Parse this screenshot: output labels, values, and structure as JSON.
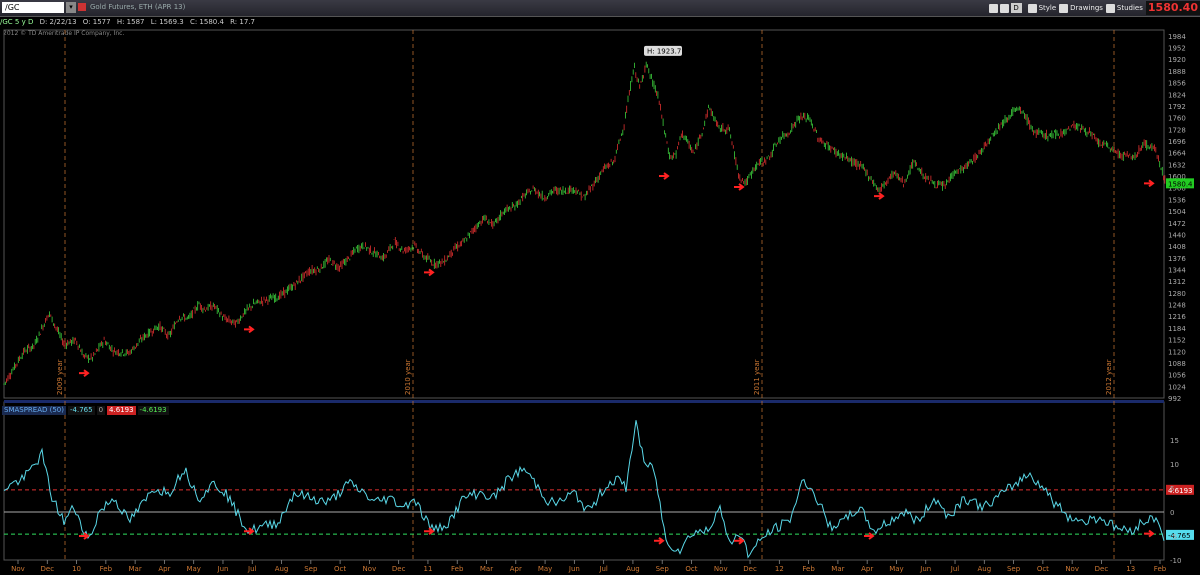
{
  "toolbar": {
    "symbol": "/GC",
    "instrument": "Gold Futures, ETH (APR 13)",
    "style_label": "Style",
    "drawings_label": "Drawings",
    "studies_label": "Studies",
    "d_label": "D",
    "last_price": "1580.40"
  },
  "info": {
    "symbol": "/GC 5 y D",
    "date": "D: 2/22/13",
    "open": "O: 1577",
    "high": "H: 1587",
    "low": "L: 1569.3",
    "close": "C: 1580.4",
    "range": "R: 17.7"
  },
  "copyright": "2012 © TD Ameritrade IP Company, Inc.",
  "indicator": {
    "name": "SMASPREAD (50)",
    "value": "-4.765",
    "zero": "0",
    "upper": "4.6193",
    "lower": "-4.6193"
  },
  "colors": {
    "up": "#3cd03c",
    "down": "#e03030",
    "spread": "#5ad8e8",
    "axis": "#cc7733",
    "upper": "#e03030",
    "lower": "#30e060"
  },
  "chart_data": [
    {
      "type": "bar",
      "series_style": "candlestick",
      "y_ticks": [
        1984,
        1952,
        1920,
        1888,
        1856,
        1824,
        1792,
        1760,
        1728,
        1696,
        1664,
        1632,
        1600,
        1568,
        1536,
        1504,
        1472,
        1440,
        1408,
        1376,
        1344,
        1312,
        1280,
        1248,
        1216,
        1184,
        1152,
        1120,
        1088,
        1056,
        1024,
        992
      ],
      "ylim": [
        992,
        2000
      ],
      "year_markers": [
        "2009 year",
        "2010 year",
        "2011 year",
        "2012 year"
      ],
      "high_label": "H: 1923.7",
      "last_label": "1580.4",
      "x": [
        0,
        20,
        30,
        45,
        60,
        72,
        80,
        88,
        100,
        110,
        125,
        140,
        155,
        165,
        175,
        185,
        195,
        200,
        210,
        220,
        232,
        240,
        250,
        260,
        275,
        290,
        305,
        315,
        325,
        335,
        345,
        352,
        360,
        370,
        380,
        390,
        400,
        410,
        420,
        430,
        440,
        450,
        460,
        470,
        480,
        490,
        500,
        510,
        520,
        530,
        540,
        550,
        560,
        570,
        580,
        590,
        600,
        610,
        620,
        630,
        636,
        642,
        648,
        654,
        660,
        666,
        672,
        678,
        690,
        700,
        705,
        715,
        725,
        735,
        742,
        752,
        765,
        775,
        785,
        795,
        805,
        815,
        825,
        835,
        845,
        860,
        875,
        890,
        900,
        910,
        920,
        930,
        940,
        950,
        960,
        975,
        990,
        1000,
        1010,
        1015,
        1020,
        1030,
        1045,
        1060,
        1070,
        1085,
        1095,
        1105,
        1115,
        1130,
        1140,
        1152,
        1162
      ],
      "values": [
        1030,
        1120,
        1135,
        1225,
        1140,
        1150,
        1105,
        1100,
        1150,
        1120,
        1115,
        1160,
        1190,
        1160,
        1215,
        1210,
        1250,
        1235,
        1245,
        1210,
        1195,
        1225,
        1250,
        1260,
        1270,
        1300,
        1340,
        1345,
        1370,
        1350,
        1375,
        1400,
        1410,
        1390,
        1375,
        1420,
        1395,
        1410,
        1380,
        1360,
        1365,
        1400,
        1420,
        1455,
        1485,
        1465,
        1505,
        1515,
        1545,
        1565,
        1540,
        1560,
        1560,
        1565,
        1540,
        1580,
        1620,
        1640,
        1740,
        1900,
        1840,
        1910,
        1860,
        1820,
        1730,
        1650,
        1660,
        1720,
        1660,
        1740,
        1790,
        1730,
        1730,
        1600,
        1580,
        1630,
        1650,
        1700,
        1720,
        1760,
        1760,
        1700,
        1680,
        1660,
        1645,
        1620,
        1560,
        1610,
        1580,
        1640,
        1600,
        1580,
        1570,
        1610,
        1620,
        1660,
        1720,
        1750,
        1780,
        1780,
        1770,
        1720,
        1710,
        1720,
        1740,
        1720,
        1690,
        1680,
        1660,
        1650,
        1690,
        1670,
        1580
      ]
    },
    {
      "type": "line",
      "ylim": [
        -10,
        20
      ],
      "y_ticks": [
        15,
        10,
        5,
        0,
        -5,
        -10
      ],
      "x_ticks": [
        "Nov",
        "Dec",
        "10",
        "Feb",
        "Mar",
        "Apr",
        "May",
        "Jun",
        "Jul",
        "Aug",
        "Sep",
        "Oct",
        "Nov",
        "Dec",
        "11",
        "Feb",
        "Mar",
        "Apr",
        "May",
        "Jun",
        "Jul",
        "Aug",
        "Sep",
        "Oct",
        "Nov",
        "Dec",
        "12",
        "Feb",
        "Mar",
        "Apr",
        "May",
        "Jun",
        "Jul",
        "Aug",
        "Sep",
        "Oct",
        "Nov",
        "Dec",
        "13",
        "Feb"
      ],
      "last_label": "-4.765",
      "series": [
        {
          "name": "SMASPREAD (50)",
          "x": [
            0,
            20,
            38,
            48,
            60,
            70,
            85,
            95,
            110,
            125,
            140,
            150,
            165,
            180,
            195,
            210,
            222,
            235,
            245,
            260,
            275,
            290,
            305,
            325,
            345,
            360,
            370,
            385,
            400,
            410,
            420,
            430,
            445,
            460,
            475,
            490,
            505,
            520,
            535,
            545,
            555,
            570,
            585,
            600,
            612,
            622,
            632,
            640,
            650,
            662,
            675,
            690,
            705,
            715,
            725,
            735,
            745,
            760,
            775,
            785,
            800,
            815,
            825,
            840,
            855,
            870,
            885,
            900,
            915,
            930,
            945,
            960,
            980,
            1000,
            1012,
            1025,
            1040,
            1050,
            1065,
            1080,
            1095,
            1110,
            1125,
            1140,
            1152,
            1160
          ],
          "values": [
            5,
            7,
            12,
            3,
            -2,
            1,
            -6,
            0,
            3,
            -2,
            2,
            5,
            4,
            9,
            3,
            6,
            4,
            -1,
            -4,
            -3,
            -2,
            4,
            3,
            2,
            6,
            4,
            2,
            3,
            1,
            3,
            -1,
            -4,
            -2,
            3,
            4,
            3,
            7,
            9,
            5,
            2,
            2,
            4,
            0,
            5,
            7,
            5,
            19,
            10,
            9,
            -6,
            -8,
            -4,
            -4,
            2,
            -7,
            -4,
            -9,
            -5,
            -3,
            -2,
            7,
            2,
            -3,
            -2,
            1,
            -4,
            -2,
            0,
            -2,
            3,
            -1,
            3,
            1,
            4,
            6,
            8,
            5,
            2,
            -1,
            -2,
            -1,
            -3,
            -4,
            -2,
            -1,
            -5
          ]
        }
      ]
    }
  ]
}
